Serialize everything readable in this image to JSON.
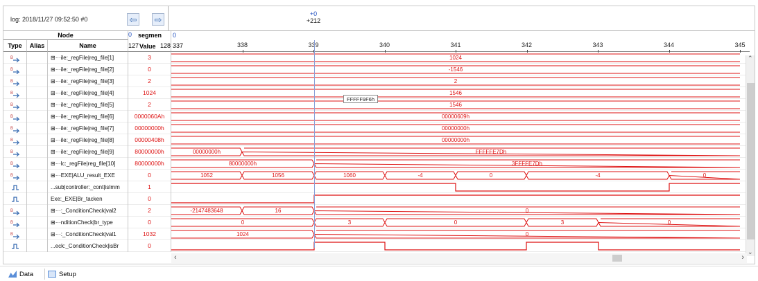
{
  "header": {
    "log": "log: 2018/11/27 09:52:50  #0",
    "cursor_top": "+0",
    "cursor_bottom": "+212"
  },
  "columns": {
    "node": "Node",
    "type": "Type",
    "alias": "Alias",
    "name": "Name",
    "value_head_top": "segmen",
    "value_head_top_left": "0",
    "value_head_bottom": "Value",
    "value_left": "127",
    "value_right": "128",
    "timescale_left": "0",
    "first_tick": "337"
  },
  "ticks": [
    "338",
    "339",
    "340",
    "341",
    "342",
    "343",
    "344",
    "345"
  ],
  "tooltip": "FFFFF9F6h",
  "rows": [
    {
      "name": "⊞···ile:_regFile|reg_file[1]",
      "value": "3",
      "kind": "bus",
      "segs": [
        {
          "t": "1024"
        }
      ]
    },
    {
      "name": "⊞···ile:_regFile|reg_file[2]",
      "value": "0",
      "kind": "bus",
      "segs": [
        {
          "t": "-1546"
        }
      ]
    },
    {
      "name": "⊞···ile:_regFile|reg_file[3]",
      "value": "2",
      "kind": "bus",
      "segs": [
        {
          "t": "2"
        }
      ]
    },
    {
      "name": "⊞···ile:_regFile|reg_file[4]",
      "value": "1024",
      "kind": "bus",
      "segs": [
        {
          "t": "1546"
        }
      ]
    },
    {
      "name": "⊞···ile:_regFile|reg_file[5]",
      "value": "2",
      "kind": "bus",
      "segs": [
        {
          "t": "1546"
        }
      ]
    },
    {
      "name": "⊞···ile:_regFile|reg_file[6]",
      "value": "0000060Ah",
      "kind": "bus",
      "segs": [
        {
          "t": "00000609h"
        }
      ]
    },
    {
      "name": "⊞···ile:_regFile|reg_file[7]",
      "value": "00000000h",
      "kind": "bus",
      "segs": [
        {
          "t": "00000000h"
        }
      ]
    },
    {
      "name": "⊞···ile:_regFile|reg_file[8]",
      "value": "00000408h",
      "kind": "bus",
      "segs": [
        {
          "t": "00000000h"
        }
      ]
    },
    {
      "name": "⊞···ile:_regFile|reg_file[9]",
      "value": "80000000h",
      "kind": "bus",
      "segs": [
        {
          "t": "00000000h"
        },
        {
          "t": "FFFFFE7Dh"
        }
      ]
    },
    {
      "name": "⊞···lc:_regFile|reg_file[10]",
      "value": "80000000h",
      "kind": "bus",
      "segs": [
        {
          "t": "80000000h"
        },
        {
          "t": "3FFFFE7Dh"
        }
      ]
    },
    {
      "name": "⊞···EXE|ALU_result_EXE",
      "value": "0",
      "kind": "bus",
      "segs": [
        {
          "t": "1052"
        },
        {
          "t": "1056"
        },
        {
          "t": "1060"
        },
        {
          "t": "-4"
        },
        {
          "t": "0"
        },
        {
          "t": "-4"
        },
        {
          "t": "0"
        }
      ]
    },
    {
      "name": "...sub|controller:_cont|isImm",
      "value": "1",
      "kind": "bit",
      "segs": []
    },
    {
      "name": "Exe:_EXE|Br_tacken",
      "value": "0",
      "kind": "bit",
      "segs": []
    },
    {
      "name": "⊞···:_ConditionCheck|val2",
      "value": "2",
      "kind": "bus",
      "segs": [
        {
          "t": "-2147483648"
        },
        {
          "t": "16"
        },
        {
          "t": "0"
        }
      ]
    },
    {
      "name": "⊞···nditionCheck|br_type",
      "value": "0",
      "kind": "bus",
      "segs": [
        {
          "t": "0"
        },
        {
          "t": "3"
        },
        {
          "t": "0"
        },
        {
          "t": "3"
        },
        {
          "t": "0"
        }
      ]
    },
    {
      "name": "⊞···:_ConditionCheck|val1",
      "value": "1032",
      "kind": "bus",
      "segs": [
        {
          "t": "1024"
        },
        {
          "t": "0"
        }
      ]
    },
    {
      "name": "...eck:_ConditionCheck|isBr",
      "value": "0",
      "kind": "bit",
      "segs": []
    }
  ],
  "tabs": [
    "Data",
    "Setup"
  ],
  "colors": {
    "signal": "#dd1111",
    "cursor": "#2050c0"
  }
}
